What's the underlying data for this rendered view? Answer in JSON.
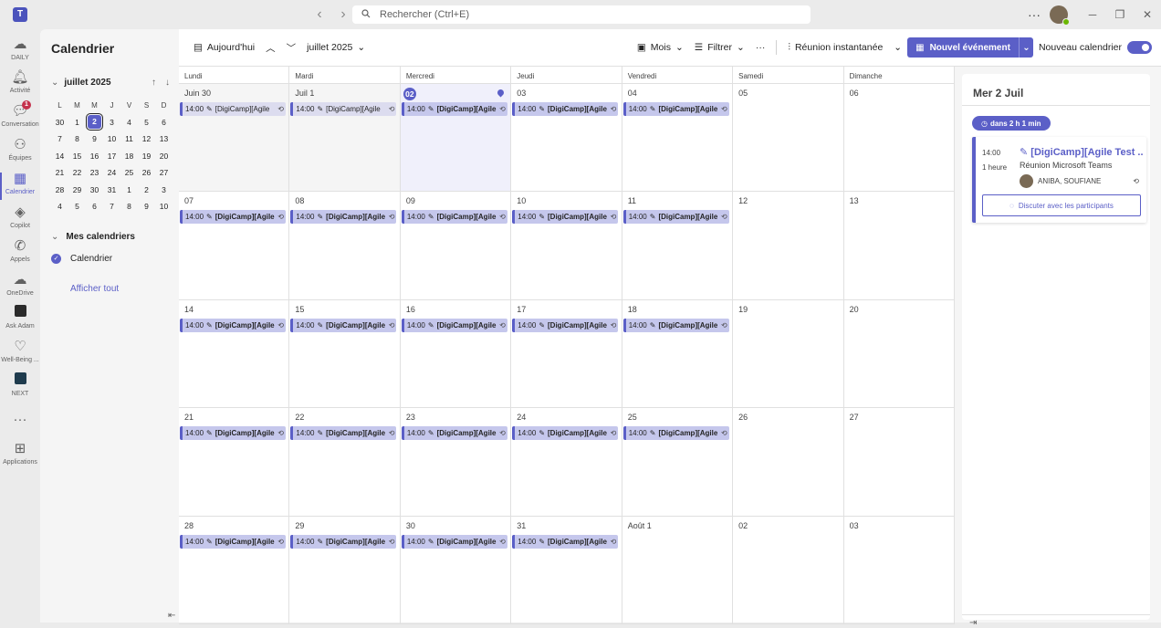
{
  "titlebar": {
    "search_placeholder": "Rechercher (Ctrl+E)",
    "more": "···"
  },
  "rail": [
    {
      "label": "DAILY",
      "icon": "daily-icon"
    },
    {
      "label": "Activité",
      "icon": "bell-icon"
    },
    {
      "label": "Conversation",
      "icon": "chat-icon",
      "badge": "1"
    },
    {
      "label": "Équipes",
      "icon": "teams-icon"
    },
    {
      "label": "Calendrier",
      "icon": "calendar-icon",
      "active": true
    },
    {
      "label": "Copilot",
      "icon": "copilot-icon"
    },
    {
      "label": "Appels",
      "icon": "phone-icon"
    },
    {
      "label": "OneDrive",
      "icon": "cloud-icon"
    },
    {
      "label": "Ask Adam",
      "icon": "ask-adam-icon"
    },
    {
      "label": "Well-Being ...",
      "icon": "wellbeing-icon"
    },
    {
      "label": "NEXT",
      "icon": "next-icon"
    },
    {
      "label": "···",
      "icon": "more-icon"
    },
    {
      "label": "Applications",
      "icon": "apps-icon"
    }
  ],
  "left": {
    "title": "Calendrier",
    "mini_month": "juillet 2025",
    "dow": [
      "L",
      "M",
      "M",
      "J",
      "V",
      "S",
      "D"
    ],
    "mini_weeks": [
      [
        "30",
        "1",
        "2",
        "3",
        "4",
        "5",
        "6"
      ],
      [
        "7",
        "8",
        "9",
        "10",
        "11",
        "12",
        "13"
      ],
      [
        "14",
        "15",
        "16",
        "17",
        "18",
        "19",
        "20"
      ],
      [
        "21",
        "22",
        "23",
        "24",
        "25",
        "26",
        "27"
      ],
      [
        "28",
        "29",
        "30",
        "31",
        "1",
        "2",
        "3"
      ],
      [
        "4",
        "5",
        "6",
        "7",
        "8",
        "9",
        "10"
      ]
    ],
    "my_calendars": "Mes calendriers",
    "calendar_item": "Calendrier",
    "show_all": "Afficher tout"
  },
  "toolbar": {
    "today": "Aujourd'hui",
    "month": "juillet 2025",
    "view": "Mois",
    "filter": "Filtrer",
    "more": "···",
    "instant": "Réunion instantanée",
    "new_event": "Nouvel événement",
    "new_calendar": "Nouveau calendrier"
  },
  "calendar": {
    "dow": [
      "Lundi",
      "Mardi",
      "Mercredi",
      "Jeudi",
      "Vendredi",
      "Samedi",
      "Dimanche"
    ],
    "event_time": "14:00",
    "event_title": "[DigiCamp][Agile",
    "weeks": [
      [
        "Juin 30",
        "Juil 1",
        "02",
        "03",
        "04",
        "05",
        "06"
      ],
      [
        "07",
        "08",
        "09",
        "10",
        "11",
        "12",
        "13"
      ],
      [
        "14",
        "15",
        "16",
        "17",
        "18",
        "19",
        "20"
      ],
      [
        "21",
        "22",
        "23",
        "24",
        "25",
        "26",
        "27"
      ],
      [
        "28",
        "29",
        "30",
        "31",
        "Août 1",
        "02",
        "03"
      ]
    ],
    "event_days": [
      [
        true,
        true,
        true,
        true,
        true,
        false,
        false
      ],
      [
        true,
        true,
        true,
        true,
        true,
        false,
        false
      ],
      [
        true,
        true,
        true,
        true,
        true,
        false,
        false
      ],
      [
        true,
        true,
        true,
        true,
        true,
        false,
        false
      ],
      [
        true,
        true,
        true,
        true,
        false,
        false,
        false
      ]
    ]
  },
  "side": {
    "date": "Mer 2 Juil",
    "countdown": "dans 2 h 1 min",
    "time": "14:00",
    "duration": "1 heure",
    "title": "[DigiCamp][Agile Test ...",
    "subtitle": "Réunion Microsoft Teams",
    "organizer": "ANIBA, SOUFIANE",
    "chat": "Discuter avec les participants"
  },
  "colors": {
    "accent": "#5b5fc7",
    "event_bg": "#c5c7ec",
    "badge": "#c4314b"
  }
}
